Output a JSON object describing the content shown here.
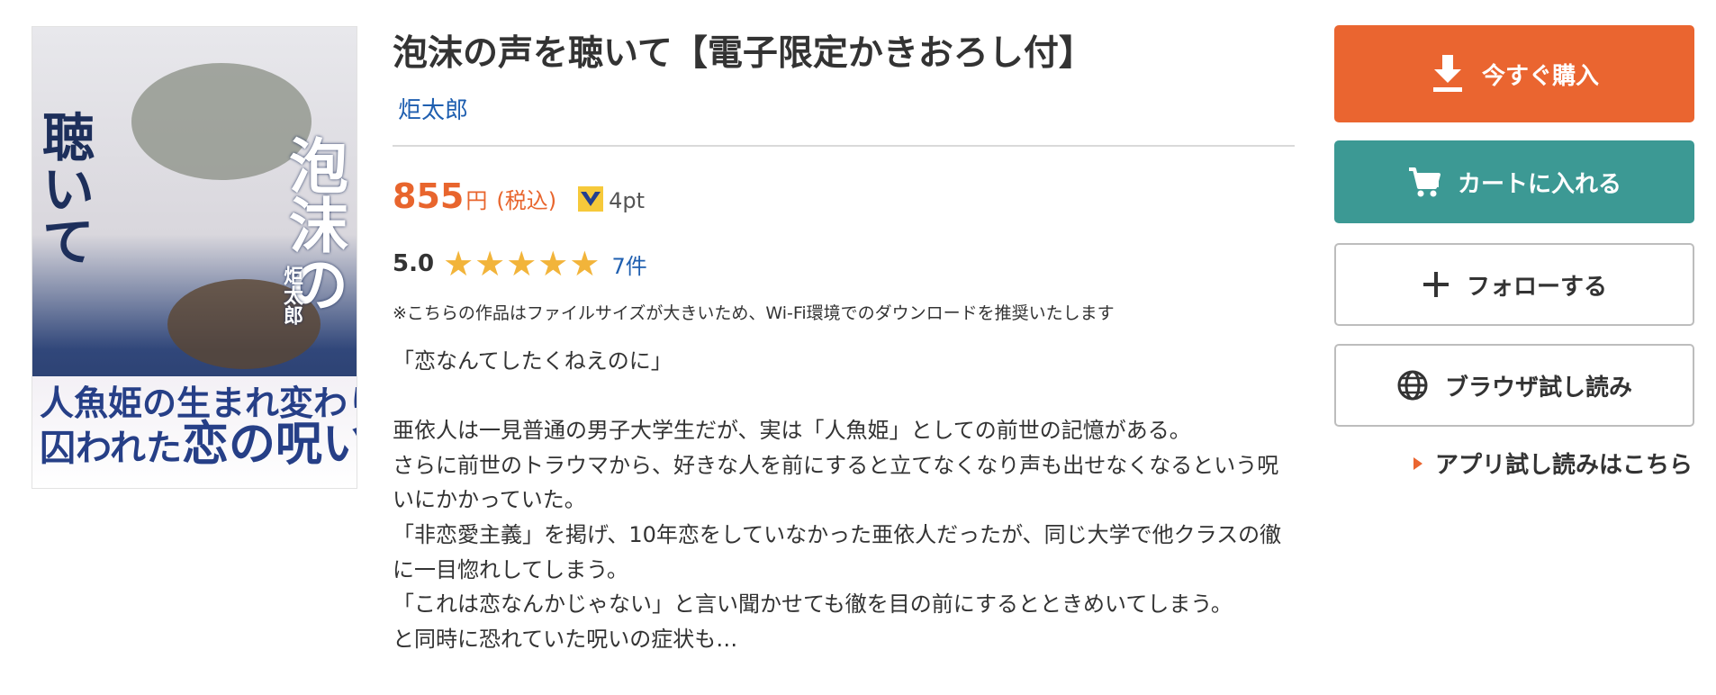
{
  "cover": {
    "title_vertical_1": "泡沫の",
    "title_vertical_2": "聴いて",
    "author_vertical": "炬太郎",
    "tagline_1": "人魚姫の生まれ変わりが",
    "tagline_2_a": "囚われた",
    "tagline_2_b": "恋の呪い"
  },
  "book": {
    "title": "泡沫の声を聴いて【電子限定かきおろし付】",
    "author": "炬太郎"
  },
  "price": {
    "amount": "855",
    "unit": "円",
    "tax_note": "(税込)",
    "points": "4pt"
  },
  "rating": {
    "score": "5.0",
    "stars": 5,
    "review_count": "7件"
  },
  "notice": "※こちらの作品はファイルサイズが大きいため、Wi-Fi環境でのダウンロードを推奨いたします",
  "synopsis": {
    "lines": [
      "「恋なんてしたくねえのに」",
      "",
      "亜依人は一見普通の男子大学生だが、実は「人魚姫」としての前世の記憶がある。",
      "さらに前世のトラウマから、好きな人を前にすると立てなくなり声も出せなくなるという呪いにかかっていた。",
      "「非恋愛主義」を掲げ、10年恋をしていなかった亜依人だったが、同じ大学で他クラスの徹に一目惚れしてしまう。",
      "「これは恋なんかじゃない」と言い聞かせても徹を目の前にするとときめいてしまう。",
      "と同時に恐れていた呪いの症状も…"
    ]
  },
  "actions": {
    "buy_label": "今すぐ購入",
    "cart_label": "カートに入れる",
    "follow_label": "フォローする",
    "browser_trial_label": "ブラウザ試し読み",
    "app_trial_label": "アプリ試し読みはこちら"
  },
  "colors": {
    "accent_orange": "#ea6530",
    "cart_teal": "#3c9994",
    "link_blue": "#1f5fb0",
    "star_gold": "#f2b43a"
  }
}
